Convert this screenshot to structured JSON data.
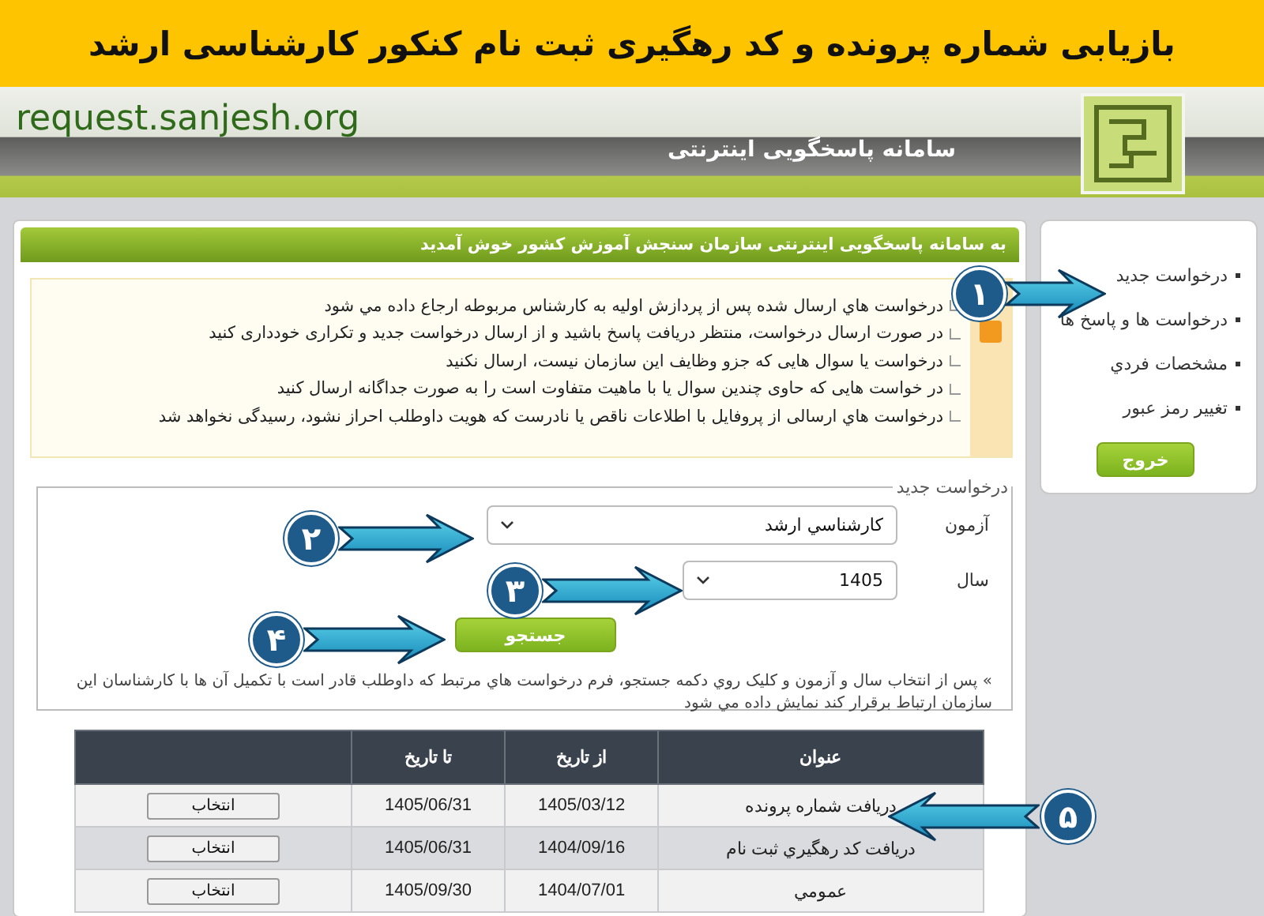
{
  "banner": {
    "title": "بازیابی شماره پرونده و کد رهگیری ثبت نام کنکور کارشناسی ارشد"
  },
  "header": {
    "site_address": "request.sanjesh.org",
    "system_name": "سامانه پاسخگویی اینترنتی"
  },
  "welcome": "به سامانه پاسخگویی اینترنتی سازمان سنجش آموزش کشور خوش آمدید",
  "notices": [
    "درخواست هاي ارسال شده پس از پردازش اوليه به کارشناس مربوطه ارجاع داده مي شود",
    "در صورت ارسال درخواست، منتظر دریافت پاسخ باشید و از ارسال درخواست جدید و تکراری خودداری کنید",
    "درخواست یا سوال هایی که جزو وظایف این سازمان نیست، ارسال نکنید",
    "در خواست هایی که حاوی چندین سوال یا با ماهیت متفاوت است را به صورت جداگانه ارسال کنید",
    "درخواست هاي ارسالی از پروفایل با اطلاعات ناقص یا نادرست که هویت داوطلب احراز نشود، رسیدگی نخواهد شد"
  ],
  "form": {
    "legend": "درخواست جدید",
    "fields": [
      {
        "label": "آزمون",
        "value": "کارشناسي ارشد"
      },
      {
        "label": "سال",
        "value": "1405"
      }
    ],
    "search_button": "جستجو",
    "help": "» پس از انتخاب سال و آزمون و کلیک روي دکمه جستجو، فرم درخواست هاي مرتبط که داوطلب قادر است با تکمیل آن ها با کارشناسان این سازمان ارتباط برقرار کند نمایش داده مي شود"
  },
  "table": {
    "columns": [
      "عنوان",
      "از تاریخ",
      "تا تاریخ"
    ],
    "rows": [
      {
        "title": "دریافت شماره پرونده",
        "from": "1405/03/12",
        "to": "1405/06/31",
        "action": "انتخاب"
      },
      {
        "title": "دریافت کد رهگیري ثبت نام",
        "from": "1404/09/16",
        "to": "1405/06/31",
        "action": "انتخاب"
      },
      {
        "title": "عمومي",
        "from": "1404/07/01",
        "to": "1405/09/30",
        "action": "انتخاب"
      }
    ]
  },
  "sidebar": {
    "items": [
      "درخواست جدید",
      "درخواست ها و پاسخ ها",
      "مشخصات فردي",
      "تغییر رمز عبور"
    ],
    "logout": "خروج"
  },
  "callouts": [
    {
      "number": "۱"
    },
    {
      "number": "۲"
    },
    {
      "number": "۳"
    },
    {
      "number": "۴"
    },
    {
      "number": "۵"
    }
  ]
}
